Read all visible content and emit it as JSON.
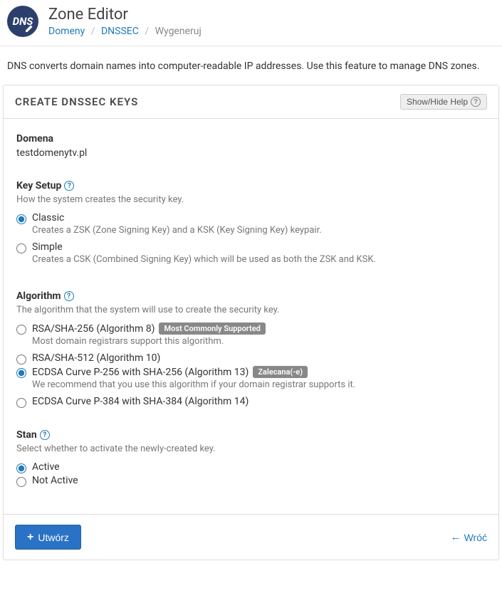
{
  "header": {
    "title": "Zone Editor",
    "icon_text": "DNS",
    "breadcrumb": {
      "items": [
        "Domeny",
        "DNSSEC"
      ],
      "current": "Wygeneruj"
    }
  },
  "intro": "DNS converts domain names into computer-readable IP addresses. Use this feature to manage DNS zones.",
  "panel": {
    "title": "CREATE DNSSEC KEYS",
    "help_button": "Show/Hide Help"
  },
  "domain_section": {
    "label": "Domena",
    "value": "testdomenytv.pl"
  },
  "key_setup": {
    "label": "Key Setup",
    "desc": "How the system creates the security key.",
    "options": {
      "classic": {
        "label": "Classic",
        "desc": "Creates a ZSK (Zone Signing Key) and a KSK (Key Signing Key) keypair."
      },
      "simple": {
        "label": "Simple",
        "desc": "Creates a CSK (Combined Signing Key) which will be used as both the ZSK and KSK."
      }
    }
  },
  "algorithm": {
    "label": "Algorithm",
    "desc": "The algorithm that the system will use to create the security key.",
    "options": {
      "rsa256": {
        "label": "RSA/SHA-256 (Algorithm 8)",
        "badge": "Most Commonly Supported",
        "desc": "Most domain registrars support this algorithm."
      },
      "rsa512": {
        "label": "RSA/SHA-512 (Algorithm 10)"
      },
      "ecdsa256": {
        "label": "ECDSA Curve P-256 with SHA-256 (Algorithm 13)",
        "badge": "Zalecana(-e)",
        "desc": "We recommend that you use this algorithm if your domain registrar supports it."
      },
      "ecdsa384": {
        "label": "ECDSA Curve P-384 with SHA-384 (Algorithm 14)"
      }
    }
  },
  "state": {
    "label": "Stan",
    "desc": "Select whether to activate the newly-created key.",
    "options": {
      "active": {
        "label": "Active"
      },
      "inactive": {
        "label": "Not Active"
      }
    }
  },
  "footer": {
    "create": "Utwórz",
    "back": "Wróć"
  }
}
